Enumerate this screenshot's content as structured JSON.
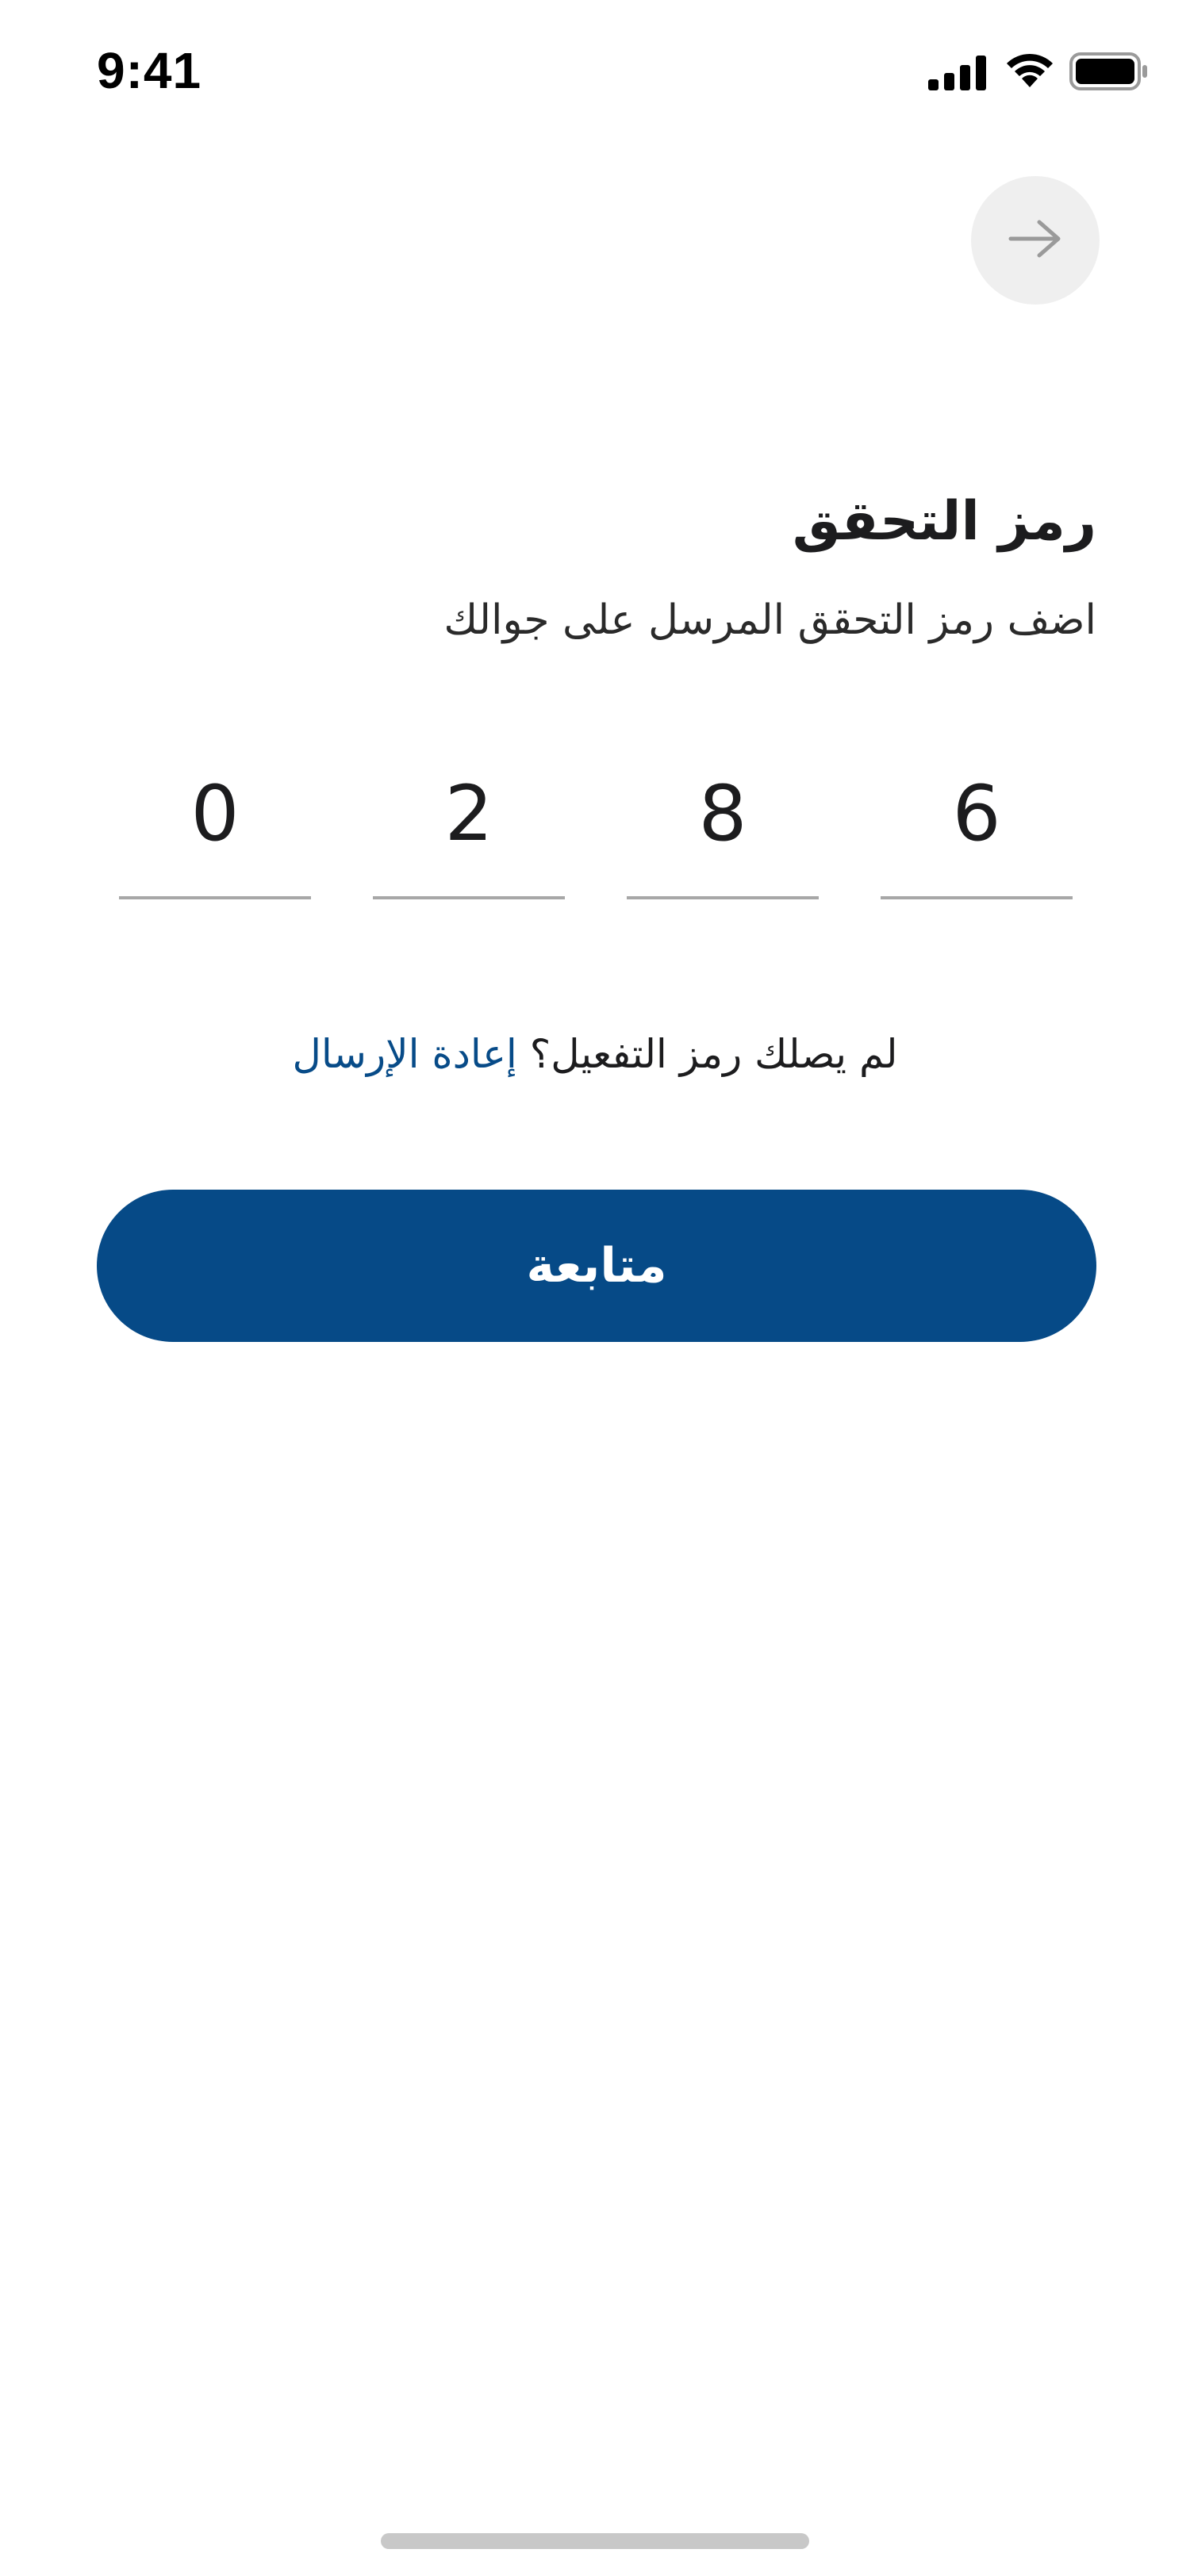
{
  "status_bar": {
    "time": "9:41",
    "icons": [
      "cellular-signal-icon",
      "wifi-icon",
      "battery-icon"
    ]
  },
  "nav": {
    "icon": "arrow-right-icon"
  },
  "header": {
    "title": "رمز التحقق",
    "subtitle": "اضف رمز التحقق المرسل على جوالك"
  },
  "otp": {
    "digits": [
      "6",
      "8",
      "2",
      "0"
    ]
  },
  "resend": {
    "question": "لم يصلك رمز التفعيل؟",
    "link_label": "إعادة الإرسال"
  },
  "actions": {
    "continue_label": "متابعة"
  },
  "colors": {
    "primary": "#064a87",
    "link": "#074b88",
    "nav_button_bg": "#efefef",
    "underline": "#a7a7a7"
  }
}
